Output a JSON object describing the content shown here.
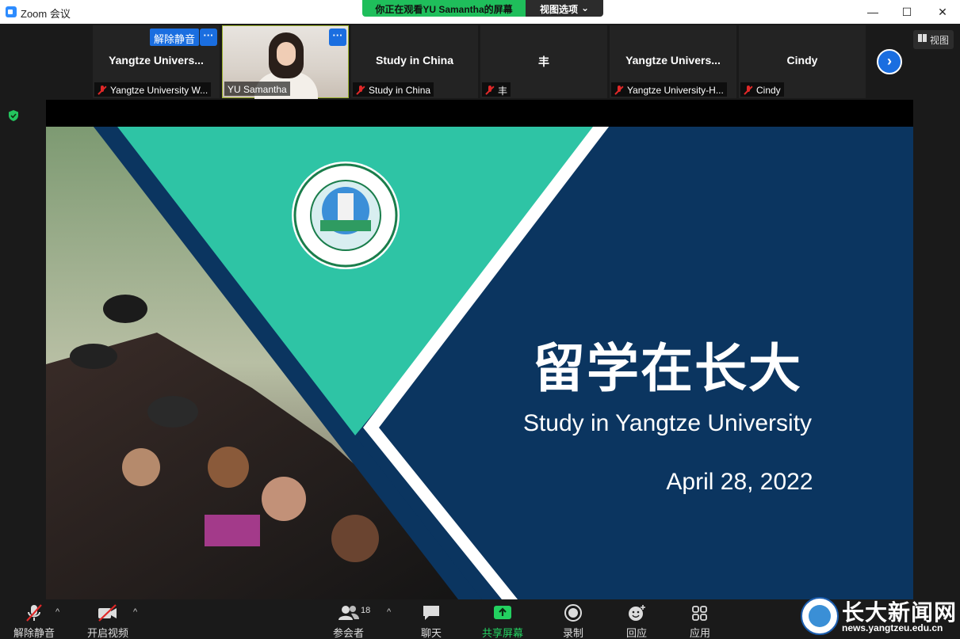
{
  "window": {
    "title": "Zoom 会议",
    "min": "—",
    "max": "☐",
    "close": "✕"
  },
  "banner": {
    "viewing": "你正在观看YU  Samantha的屏幕",
    "view_options": "视图选项",
    "chevron": "⌄"
  },
  "gallery": {
    "unmute_badge": "解除静音",
    "more": "···",
    "tiles": [
      {
        "name": "Yangtze  Univers...",
        "label": "Yangtze University W..."
      },
      {
        "name": "",
        "label": "YU Samantha"
      },
      {
        "name": "Study in China",
        "label": "Study in China"
      },
      {
        "name": "丰",
        "label": "丰"
      },
      {
        "name": "Yangtze  Univers...",
        "label": "Yangtze University-H..."
      },
      {
        "name": "Cindy",
        "label": "Cindy"
      }
    ],
    "next": "›",
    "view_button": "视图"
  },
  "slide": {
    "title": "留学在长大",
    "subtitle": "Study in Yangtze University",
    "date": "April 28, 2022",
    "colors": {
      "navy": "#0b3560",
      "teal": "#2ec4a5",
      "white_stripe": "#ffffff"
    }
  },
  "toolbar": {
    "unmute": "解除静音",
    "start_video": "开启视频",
    "participants": "参会者",
    "participants_count": "18",
    "chat": "聊天",
    "share_screen": "共享屏幕",
    "record": "录制",
    "reactions": "回应",
    "apps": "应用",
    "caret": "^"
  },
  "watermark": {
    "name": "长大新闻网",
    "url": "news.yangtzeu.edu.cn"
  }
}
